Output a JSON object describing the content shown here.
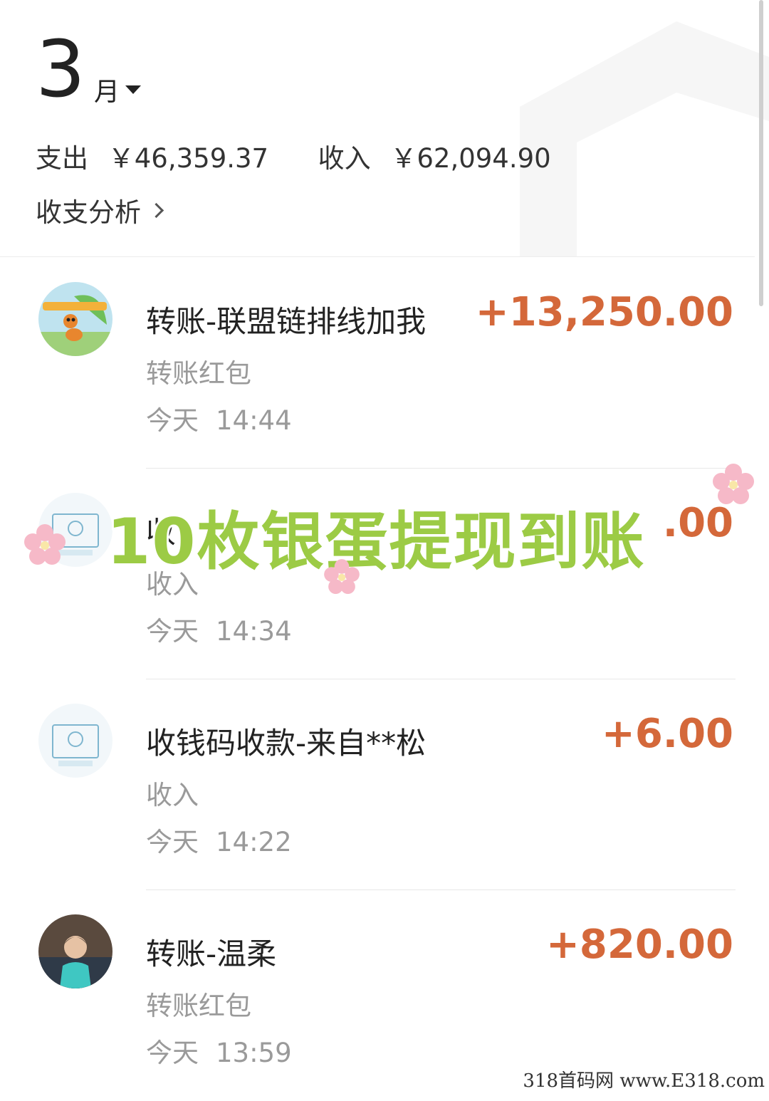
{
  "header": {
    "month_number": "3",
    "month_unit": "月",
    "expense_label": "支出",
    "expense_value": "￥46,359.37",
    "income_label": "收入",
    "income_value": "￥62,094.90",
    "analysis_label": "收支分析"
  },
  "transactions": [
    {
      "title": "转账-联盟链排线加我",
      "amount": "+13,250.00",
      "subtitle": "转账红包",
      "day": "今天",
      "time": "14:44",
      "avatar": "ant-cartoon-avatar"
    },
    {
      "title": "收",
      "amount": ".00",
      "subtitle": "收入",
      "day": "今天",
      "time": "14:34",
      "avatar": "qr-collection-avatar"
    },
    {
      "title": "收钱码收款-来自**松",
      "amount": "+6.00",
      "subtitle": "收入",
      "day": "今天",
      "time": "14:22",
      "avatar": "qr-collection-avatar"
    },
    {
      "title": "转账-温柔",
      "amount": "+820.00",
      "subtitle": "转账红包",
      "day": "今天",
      "time": "13:59",
      "avatar": "person-photo-avatar"
    }
  ],
  "overlay": {
    "banner_text": "10枚银蛋提现到账"
  },
  "watermark": {
    "text": "318首码网 www.E318.com"
  },
  "colors": {
    "amount": "#d4683a",
    "banner": "#9ccb45",
    "secondary_text": "#9a9a9a"
  }
}
